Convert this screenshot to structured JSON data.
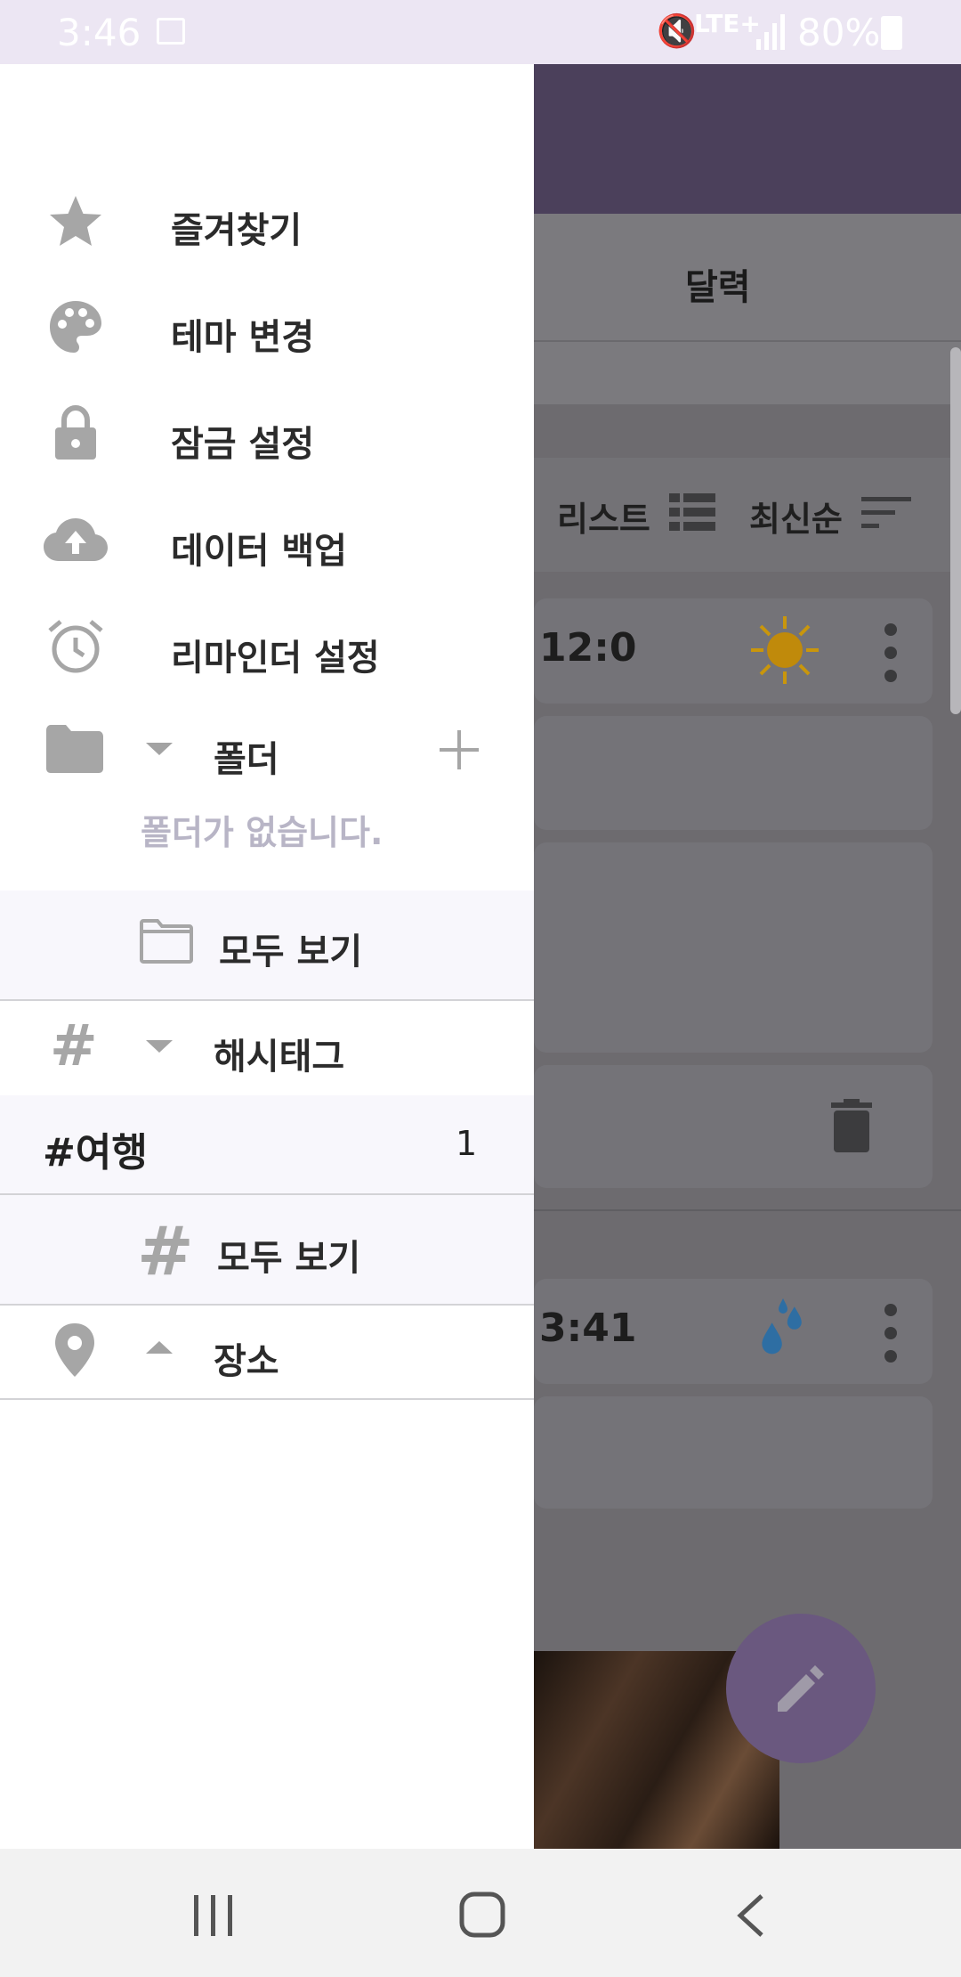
{
  "status_bar": {
    "time": "3:46",
    "network": "LTE+",
    "battery": "80%"
  },
  "background_app": {
    "tab_title": "달력",
    "view_mode_label": "리스트",
    "sort_label": "최신순",
    "entries": [
      {
        "time": "12:0",
        "weather": "sunny-icon"
      },
      {
        "time": "3:41",
        "weather": "rain-icon"
      }
    ],
    "fab_icon": "pencil-icon"
  },
  "drawer": {
    "menu": [
      {
        "label": "즐겨찾기",
        "icon": "star-icon"
      },
      {
        "label": "테마 변경",
        "icon": "palette-icon"
      },
      {
        "label": "잠금 설정",
        "icon": "lock-icon"
      },
      {
        "label": "데이터 백업",
        "icon": "cloud-upload-icon"
      },
      {
        "label": "리마인더 설정",
        "icon": "alarm-icon"
      }
    ],
    "folder": {
      "label": "폴더",
      "empty_message": "폴더가 없습니다.",
      "view_all": "모두 보기"
    },
    "hashtag": {
      "label": "해시태그",
      "items": [
        {
          "tag": "#여행",
          "count": "1"
        }
      ],
      "view_all": "모두 보기"
    },
    "place": {
      "label": "장소"
    }
  },
  "colors": {
    "accent": "#4b405b",
    "fab": "#6a587f",
    "icon_gray": "#a6a6a6",
    "status_bar": "#ece6f3"
  }
}
